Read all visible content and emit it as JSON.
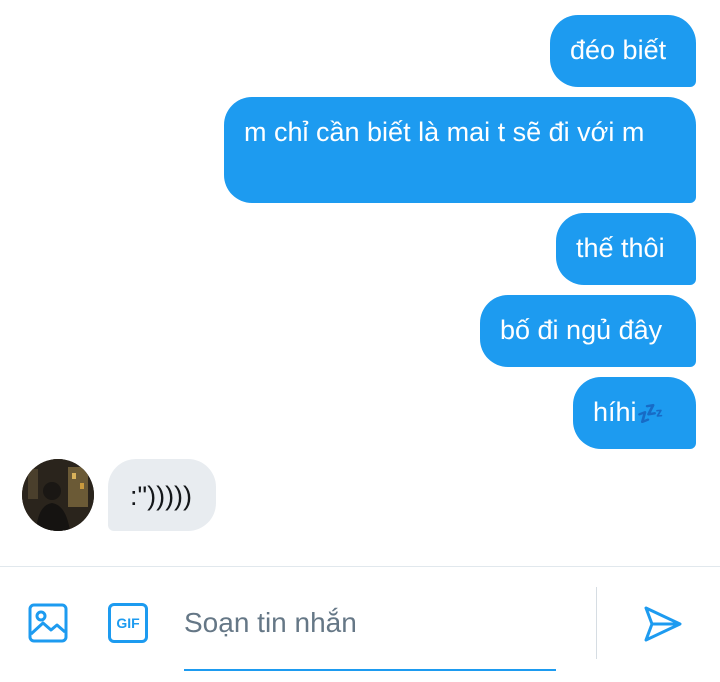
{
  "messages": [
    {
      "text": "đéo biết",
      "direction": "outgoing"
    },
    {
      "text": "m chỉ cần biết là mai t sẽ đi với m",
      "direction": "outgoing"
    },
    {
      "text": "thế thôi",
      "direction": "outgoing"
    },
    {
      "text": "bố đi ngủ đây",
      "direction": "outgoing"
    },
    {
      "text": "híhi",
      "emoji": "💤",
      "direction": "outgoing"
    },
    {
      "text": ":\")))))",
      "direction": "incoming"
    }
  ],
  "composer": {
    "placeholder": "Soạn tin nhắn",
    "gif_label": "GIF"
  },
  "colors": {
    "accent": "#1d9bf0",
    "incoming_bubble": "#e8ecf0"
  }
}
